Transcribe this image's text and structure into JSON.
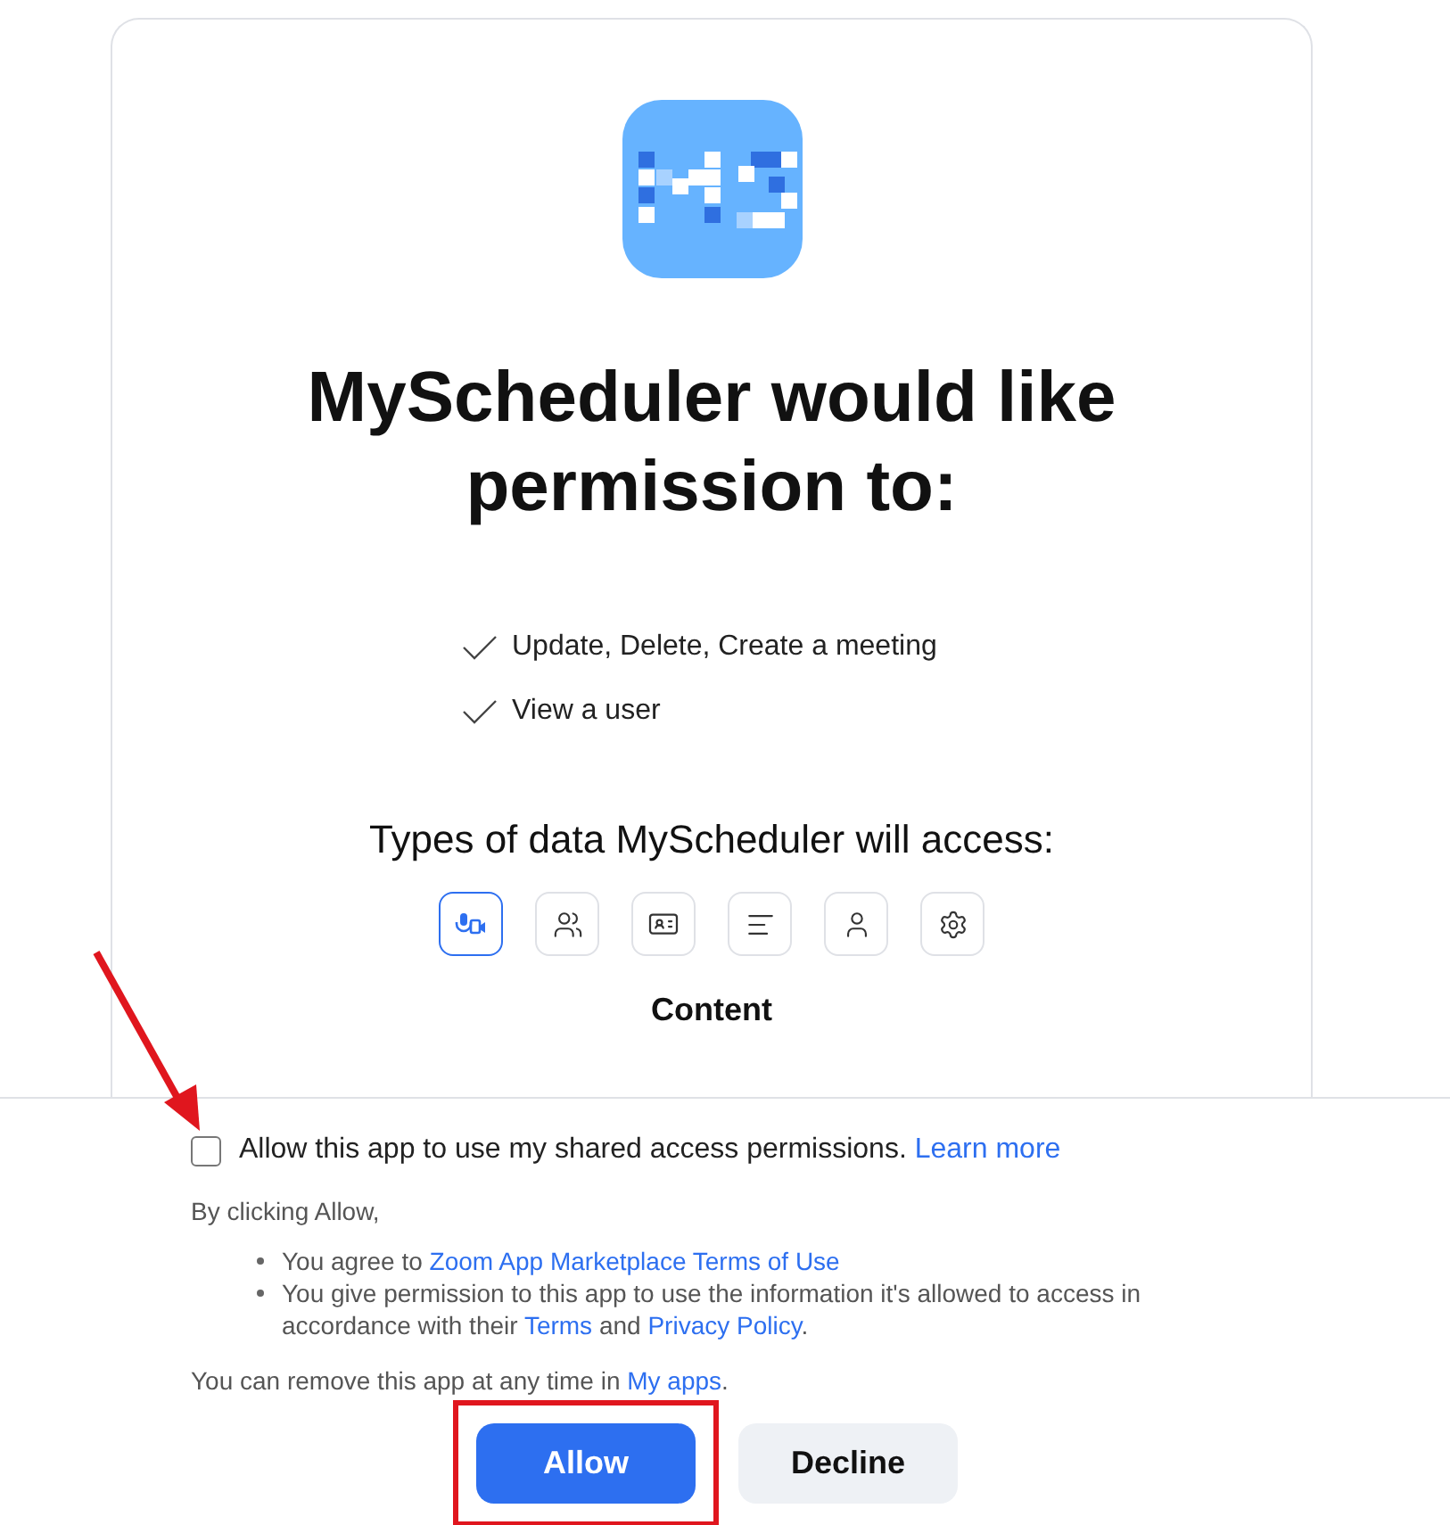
{
  "app": {
    "name_title": "MyScheduler would like permission to:"
  },
  "permissions": [
    {
      "text": "Update, Delete, Create a meeting"
    },
    {
      "text": "View a user"
    }
  ],
  "data_types": {
    "heading": "Types of data MyScheduler will access:",
    "items": [
      {
        "selected": true
      },
      {
        "selected": false
      },
      {
        "selected": false
      },
      {
        "selected": false
      },
      {
        "selected": false
      },
      {
        "selected": false
      }
    ],
    "current": "Content"
  },
  "consent": {
    "checked": false,
    "label": "Allow this app to use my shared access permissions.",
    "link": "Learn more"
  },
  "intro": "By clicking Allow,",
  "bullets": [
    [
      {
        "kind": "text",
        "text": "You agree to "
      },
      {
        "kind": "link",
        "text": "Zoom App Marketplace Terms of Use"
      }
    ],
    [
      {
        "kind": "text",
        "text": "You give permission to this app to use the information it's allowed to access in accordance with their "
      },
      {
        "kind": "link",
        "text": "Terms"
      },
      {
        "kind": "text",
        "text": " and "
      },
      {
        "kind": "link",
        "text": "Privacy Policy"
      },
      {
        "kind": "text",
        "text": "."
      }
    ]
  ],
  "removal": [
    {
      "kind": "text",
      "text": "You can remove this app at any time in "
    },
    {
      "kind": "link",
      "text": "My apps"
    },
    {
      "kind": "text",
      "text": "."
    }
  ],
  "buttons": [
    {
      "label": "Allow",
      "kind": "primary",
      "highlighted": true
    },
    {
      "label": "Decline",
      "kind": "secondary",
      "highlighted": false
    }
  ]
}
